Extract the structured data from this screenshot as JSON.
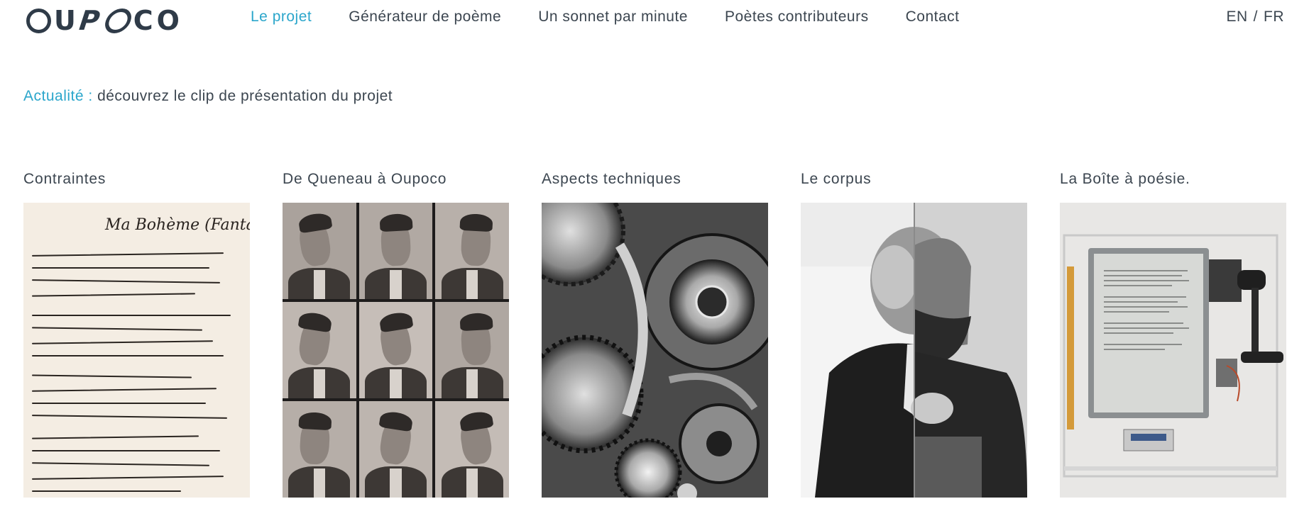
{
  "header": {
    "logo": "OUPOCO",
    "nav": [
      {
        "label": "Le projet",
        "active": true
      },
      {
        "label": "Générateur de poème",
        "active": false
      },
      {
        "label": "Un sonnet par minute",
        "active": false
      },
      {
        "label": "Poètes contributeurs",
        "active": false
      },
      {
        "label": "Contact",
        "active": false
      }
    ],
    "lang": {
      "en": "EN",
      "separator": "/",
      "fr": "FR"
    }
  },
  "news": {
    "label": "Actualité :",
    "text": "découvrez le clip de présentation du projet"
  },
  "cards": [
    {
      "title": "Contraintes",
      "image": "handwritten-manuscript-ma-boheme"
    },
    {
      "title": "De Queneau à Oupoco",
      "image": "photobooth-portrait-grid"
    },
    {
      "title": "Aspects techniques",
      "image": "watch-gears-closeup"
    },
    {
      "title": "Le corpus",
      "image": "split-poet-portrait"
    },
    {
      "title": "La Boîte à poésie.",
      "image": "poetry-box-device"
    }
  ],
  "manuscript_heading": "Ma Bohème (Fantaisie)",
  "colors": {
    "accent": "#2ba6cb",
    "text": "#3c4650",
    "logo": "#2f3b48"
  }
}
